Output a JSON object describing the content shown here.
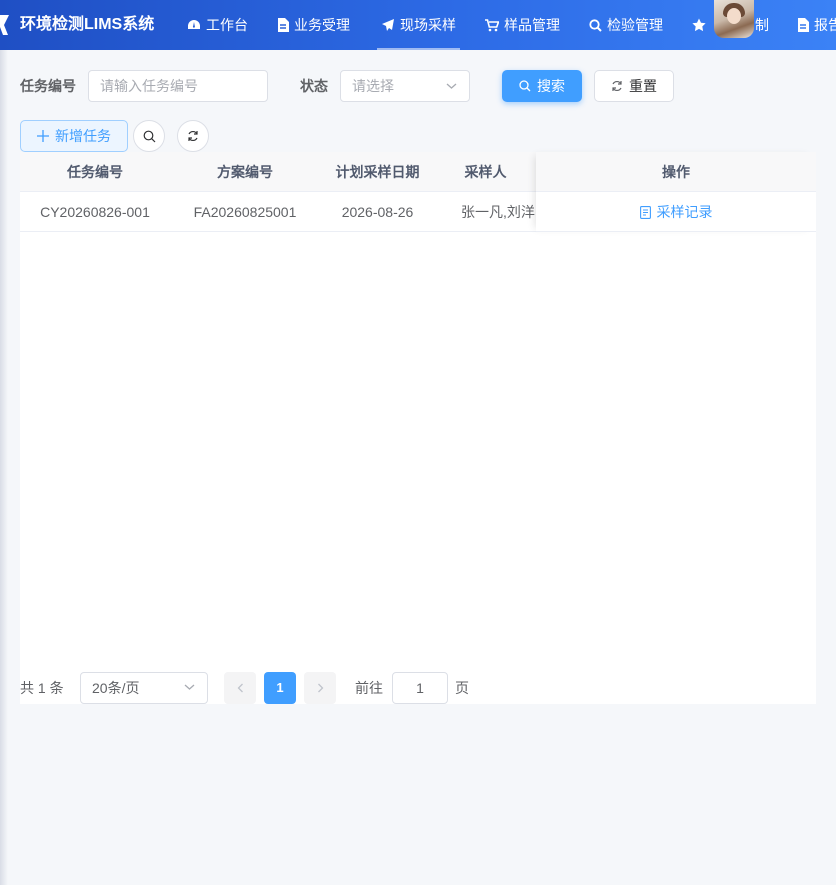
{
  "header": {
    "title": "环境检测LIMS系统",
    "nav": [
      {
        "label": "工作台",
        "icon": "dashboard-icon"
      },
      {
        "label": "业务受理",
        "icon": "document-icon"
      },
      {
        "label": "现场采样",
        "icon": "paper-plane-icon",
        "active": true
      },
      {
        "label": "样品管理",
        "icon": "cart-icon"
      },
      {
        "label": "检验管理",
        "icon": "search-icon"
      },
      {
        "label": "制",
        "icon": "star-icon"
      },
      {
        "label": "报告",
        "icon": "report-icon"
      }
    ],
    "accent": "#2d6be6"
  },
  "search_form": {
    "task_no_label": "任务编号",
    "task_no_placeholder": "请输入任务编号",
    "status_label": "状态",
    "status_placeholder": "请选择",
    "search_label": "搜索",
    "reset_label": "重置"
  },
  "toolbar": {
    "add_label": "新增任务"
  },
  "table": {
    "columns": [
      "任务编号",
      "方案编号",
      "计划采样日期",
      "采样人",
      "操作"
    ],
    "rows": [
      {
        "task_no": "CY20260826-001",
        "plan_no": "FA20260825001",
        "date": "2026-08-26",
        "sampler": "张一凡,刘洋",
        "action": "采样记录"
      }
    ]
  },
  "pagination": {
    "total_text": "共 1 条",
    "page_size": "20条/页",
    "current_page": "1",
    "goto_label": "前往",
    "goto_value": "1",
    "page_unit": "页"
  },
  "colors": {
    "primary": "#409eff"
  }
}
